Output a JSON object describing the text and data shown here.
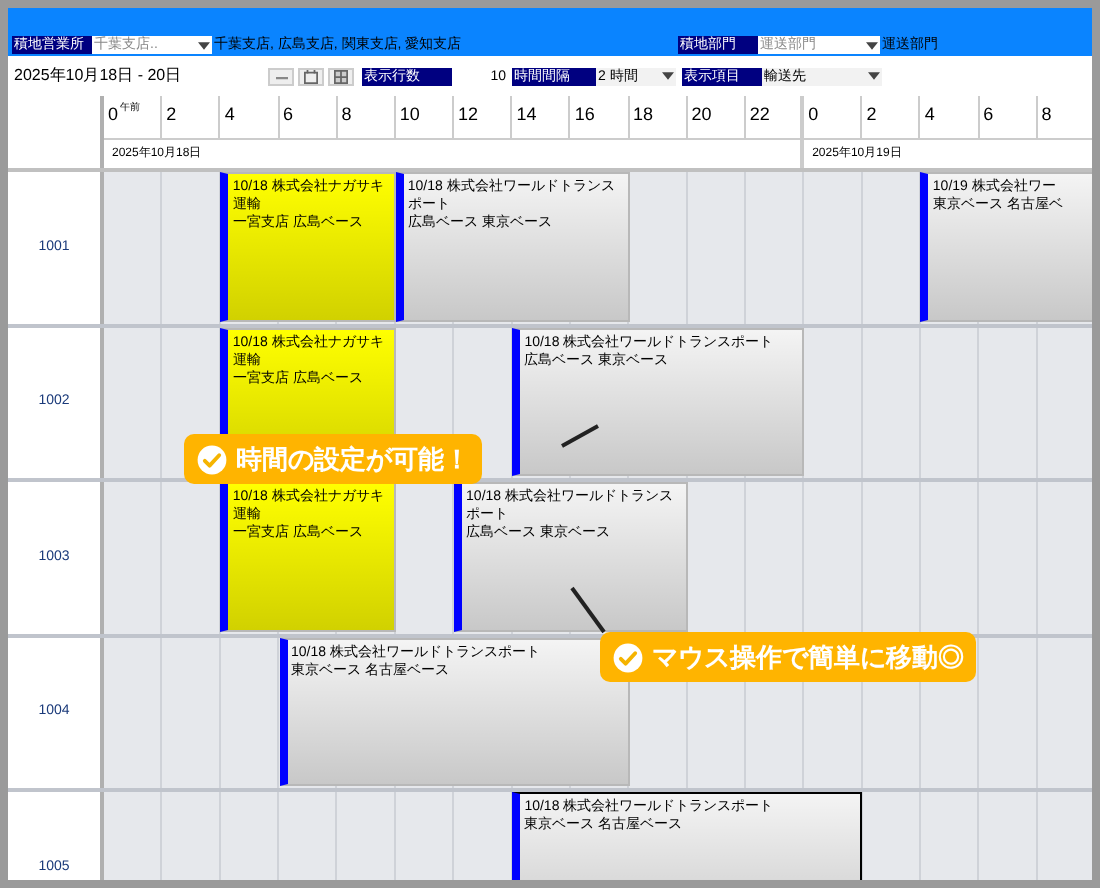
{
  "filters": {
    "office_label": "積地営業所",
    "office_select": "千葉支店..",
    "office_value": "千葉支店, 広島支店, 関東支店, 愛知支店",
    "dept_label": "積地部門",
    "dept_select": "運送部門",
    "dept_value": "運送部門"
  },
  "toolbar": {
    "date_range": "2025年10月18日 - 20日",
    "rows_label": "表示行数",
    "rows_value": "10",
    "interval_label": "時間間隔",
    "interval_value": "2 時間",
    "items_label": "表示項目",
    "items_value": "輸送先"
  },
  "timeline": {
    "am_label": "午前",
    "hours": [
      "0",
      "2",
      "4",
      "6",
      "8",
      "10",
      "12",
      "14",
      "16",
      "18",
      "20",
      "22",
      "0",
      "2",
      "4",
      "6",
      "8"
    ],
    "dates": [
      "2025年10月18日",
      "2025年10月19日"
    ]
  },
  "rows": [
    {
      "label": "1001",
      "cells": [
        {
          "kind": "empty"
        },
        {
          "kind": "empty"
        },
        {
          "kind": "event",
          "title": "10/18 株式会社ナガサキ運輸",
          "route": "一宮支店 広島ベース",
          "color": "#ffff00",
          "selected": false
        },
        {
          "kind": "more"
        },
        {
          "kind": "more"
        },
        {
          "kind": "event",
          "title": "10/18 株式会社ワールドトランスポート",
          "route": "広島ベース 東京ベース",
          "color": "#f4f4f4",
          "selected": false
        },
        {
          "kind": "more"
        },
        {
          "kind": "more"
        },
        {
          "kind": "more"
        },
        {
          "kind": "empty"
        },
        {
          "kind": "empty"
        },
        {
          "kind": "empty"
        },
        {
          "kind": "empty"
        },
        {
          "kind": "empty"
        },
        {
          "kind": "event",
          "title": "10/19 株式会社ワー",
          "route": "東京ベース 名古屋ベ",
          "color": "#f4f4f4",
          "selected": false
        },
        {
          "kind": "more"
        },
        {
          "kind": "more"
        }
      ]
    },
    {
      "label": "1002",
      "cells": [
        {
          "kind": "empty"
        },
        {
          "kind": "empty"
        },
        {
          "kind": "event",
          "title": "10/18 株式会社ナガサキ運輸",
          "route": "一宮支店 広島ベース",
          "color": "#ffff00",
          "selected": false
        },
        {
          "kind": "more"
        },
        {
          "kind": "more"
        },
        {
          "kind": "empty"
        },
        {
          "kind": "empty"
        },
        {
          "kind": "event",
          "title": "10/18 株式会社ワールドトランスポート",
          "route": "広島ベース 東京ベース",
          "color": "#f4f4f4",
          "selected": false
        },
        {
          "kind": "more"
        },
        {
          "kind": "more"
        },
        {
          "kind": "more"
        },
        {
          "kind": "more"
        },
        {
          "kind": "empty"
        },
        {
          "kind": "empty"
        },
        {
          "kind": "empty"
        },
        {
          "kind": "empty"
        },
        {
          "kind": "empty"
        }
      ]
    },
    {
      "label": "1003",
      "cells": [
        {
          "kind": "empty"
        },
        {
          "kind": "empty"
        },
        {
          "kind": "event",
          "title": "10/18 株式会社ナガサキ運輸",
          "route": "一宮支店 広島ベース",
          "color": "#ffff00",
          "selected": false
        },
        {
          "kind": "more"
        },
        {
          "kind": "more"
        },
        {
          "kind": "empty"
        },
        {
          "kind": "event",
          "title": "10/18 株式会社ワールドトランスポート",
          "route": "広島ベース 東京ベース",
          "color": "#f4f4f4",
          "selected": false
        },
        {
          "kind": "more"
        },
        {
          "kind": "more"
        },
        {
          "kind": "more"
        },
        {
          "kind": "empty"
        },
        {
          "kind": "empty"
        },
        {
          "kind": "empty"
        },
        {
          "kind": "empty"
        },
        {
          "kind": "empty"
        },
        {
          "kind": "empty"
        },
        {
          "kind": "empty"
        }
      ]
    },
    {
      "label": "1004",
      "cells": [
        {
          "kind": "empty"
        },
        {
          "kind": "empty"
        },
        {
          "kind": "empty"
        },
        {
          "kind": "event",
          "title": "10/18 株式会社ワールドトランスポート",
          "route": "東京ベース 名古屋ベース",
          "color": "#f4f4f4",
          "selected": false
        },
        {
          "kind": "more"
        },
        {
          "kind": "more"
        },
        {
          "kind": "more"
        },
        {
          "kind": "more"
        },
        {
          "kind": "more"
        },
        {
          "kind": "empty"
        },
        {
          "kind": "empty"
        },
        {
          "kind": "empty"
        },
        {
          "kind": "empty"
        },
        {
          "kind": "empty"
        },
        {
          "kind": "empty"
        },
        {
          "kind": "empty"
        },
        {
          "kind": "empty"
        }
      ]
    },
    {
      "label": "1005",
      "cells": [
        {
          "kind": "empty"
        },
        {
          "kind": "empty"
        },
        {
          "kind": "empty"
        },
        {
          "kind": "empty"
        },
        {
          "kind": "empty"
        },
        {
          "kind": "empty"
        },
        {
          "kind": "empty"
        },
        {
          "kind": "event",
          "title": "10/18 株式会社ワールドトランスポート",
          "route": "東京ベース 名古屋ベース",
          "color": "#f4f4f4",
          "selected": true
        },
        {
          "kind": "more"
        },
        {
          "kind": "more"
        },
        {
          "kind": "more"
        },
        {
          "kind": "more"
        },
        {
          "kind": "more"
        },
        {
          "kind": "empty"
        },
        {
          "kind": "empty"
        },
        {
          "kind": "empty"
        },
        {
          "kind": "empty"
        }
      ]
    }
  ],
  "callouts": [
    "時間の設定が可能！",
    "マウス操作で簡単に移動◎"
  ]
}
